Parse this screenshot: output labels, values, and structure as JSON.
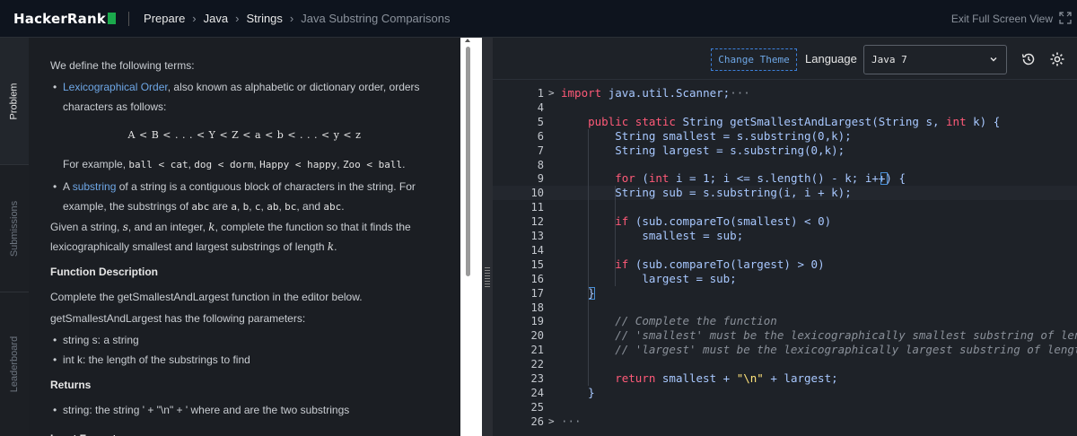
{
  "topbar": {
    "logo": "HackerRank",
    "breadcrumb": [
      "Prepare",
      "Java",
      "Strings",
      "Java Substring Comparisons"
    ],
    "exit_full_screen": "Exit Full Screen View"
  },
  "vtabs": [
    "Problem",
    "Submissions",
    "Leaderboard"
  ],
  "problem": {
    "intro": "We define the following terms:",
    "b1_link": "Lexicographical Order",
    "b1_text": ", also known as alphabetic or dictionary order, orders characters as follows:",
    "formula": "A < B < . . . < Y < Z < a < b < . . . < y < z",
    "example_prefix": "For example, ",
    "ex1": "ball < cat",
    "ex2": "dog < dorm",
    "ex3": "Happy < happy",
    "ex4": "Zoo < ball",
    "b2_prefix": "A ",
    "b2_link": "substring",
    "b2_text": " of a string is a contiguous block of characters in the string. For example, the substrings of ",
    "b2_abc": "abc",
    "b2_are": " are ",
    "b2_subs": [
      "a",
      "b",
      "c",
      "ab",
      "bc"
    ],
    "b2_and": ", and ",
    "b2_last": "abc",
    "given_1": "Given a string, ",
    "given_s": "s",
    "given_2": ", and an integer, ",
    "given_k": "k",
    "given_3": ", complete the function so that it finds the lexicographically smallest and largest substrings of length ",
    "given_k2": "k",
    "given_4": ".",
    "h_function": "Function Description",
    "complete": "Complete the getSmallestAndLargest function in the editor below.",
    "params_intro": "getSmallestAndLargest has the following parameters:",
    "params": [
      "string s: a string",
      "int k: the length of the substrings to find"
    ],
    "h_returns": "Returns",
    "returns": [
      "string: the string ' + \"\\n\" + ' where and are the two substrings"
    ],
    "h_input": "Input Format"
  },
  "editor": {
    "change_theme": "Change Theme",
    "language_label": "Language",
    "language_value": "Java 7"
  },
  "code_lines": [
    {
      "n": "1",
      "fold": ">",
      "text": "import java.util.Scanner;···"
    },
    {
      "n": "4",
      "fold": "",
      "text": ""
    },
    {
      "n": "5",
      "fold": "",
      "text": "    public static String getSmallestAndLargest(String s, int k) {"
    },
    {
      "n": "6",
      "fold": "",
      "text": "        String smallest = s.substring(0,k);"
    },
    {
      "n": "7",
      "fold": "",
      "text": "        String largest = s.substring(0,k);"
    },
    {
      "n": "8",
      "fold": "",
      "text": ""
    },
    {
      "n": "9",
      "fold": "",
      "text": "        for (int i = 1; i <= s.length() - k; i++) {"
    },
    {
      "n": "10",
      "fold": "",
      "text": "        String sub = s.substring(i, i + k);"
    },
    {
      "n": "11",
      "fold": "",
      "text": ""
    },
    {
      "n": "12",
      "fold": "",
      "text": "        if (sub.compareTo(smallest) < 0)"
    },
    {
      "n": "13",
      "fold": "",
      "text": "            smallest = sub;"
    },
    {
      "n": "14",
      "fold": "",
      "text": ""
    },
    {
      "n": "15",
      "fold": "",
      "text": "        if (sub.compareTo(largest) > 0)"
    },
    {
      "n": "16",
      "fold": "",
      "text": "            largest = sub;"
    },
    {
      "n": "17",
      "fold": "",
      "text": "    }"
    },
    {
      "n": "18",
      "fold": "",
      "text": ""
    },
    {
      "n": "19",
      "fold": "",
      "text": "        // Complete the function"
    },
    {
      "n": "20",
      "fold": "",
      "text": "        // 'smallest' must be the lexicographically smallest substring of length 'k'"
    },
    {
      "n": "21",
      "fold": "",
      "text": "        // 'largest' must be the lexicographically largest substring of length 'k'"
    },
    {
      "n": "22",
      "fold": "",
      "text": ""
    },
    {
      "n": "23",
      "fold": "",
      "text": "        return smallest + \"\\n\" + largest;"
    },
    {
      "n": "24",
      "fold": "",
      "text": "    }"
    },
    {
      "n": "25",
      "fold": "",
      "text": ""
    },
    {
      "n": "26",
      "fold": ">",
      "text": "···"
    }
  ],
  "colors": {
    "accent_green": "#1ba94c",
    "link_blue": "#6ea7e6",
    "keyword": "#ff5a78",
    "string": "#ffe37a"
  }
}
